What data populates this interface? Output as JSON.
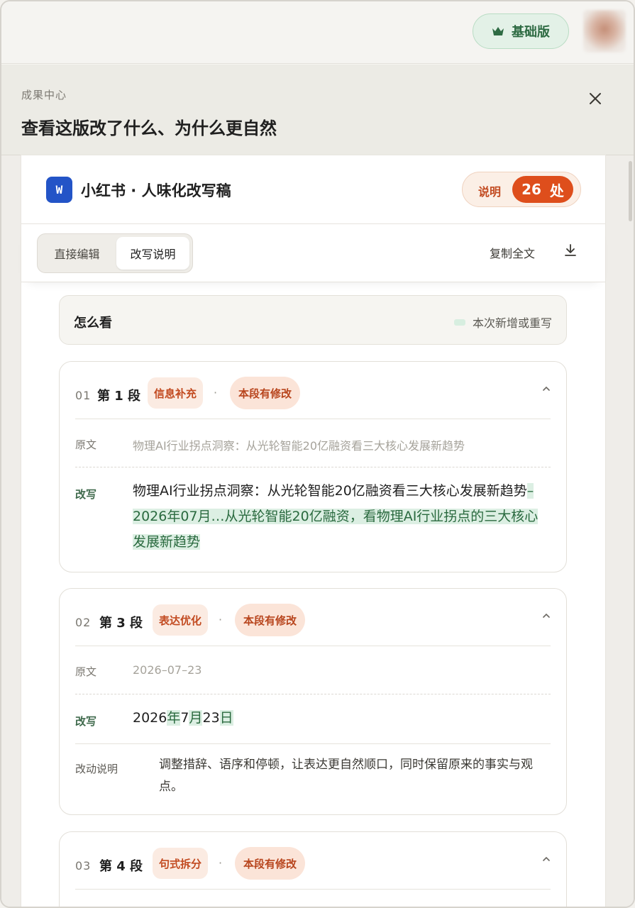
{
  "header": {
    "plan_label": "基础版",
    "plan_icon": "crown-icon"
  },
  "drawer": {
    "kicker": "成果中心",
    "title": "查看这版改了什么、为什么更自然"
  },
  "document": {
    "icon_letter": "W",
    "title": "小红书 · 人味化改写稿",
    "notes_label": "说明",
    "notes_count": "26",
    "notes_unit": "处"
  },
  "toolbar": {
    "tabs": [
      {
        "label": "直接编辑",
        "active": false
      },
      {
        "label": "改写说明",
        "active": true
      }
    ],
    "copy_all": "复制全文"
  },
  "howto": {
    "title": "怎么看",
    "legend": "本次新增或重写",
    "legend_color": "#d7eee0"
  },
  "cards": [
    {
      "num": "01",
      "segment": "第 1 段",
      "type": "信息补充",
      "sep": "·",
      "status": "本段有修改",
      "orig_label": "原文",
      "orig": "物理AI行业拐点洞察：从光轮智能20亿融资看三大核心发展新趋势",
      "rw_label": "改写",
      "rw_plain": "物理AI行业拐点洞察：从光轮智能20亿融资看三大核心发展新趋势",
      "rw_added": "–2026年07月…从光轮智能20亿融资，看物理AI行业拐点的三大核心发展新趋势"
    },
    {
      "num": "02",
      "segment": "第 3 段",
      "type": "表达优化",
      "sep": "·",
      "status": "本段有修改",
      "orig_label": "原文",
      "orig": "2026–07–23",
      "rw_label": "改写",
      "rw_parts": [
        "2026",
        "年",
        "7",
        "月",
        "23",
        "日"
      ],
      "note_label": "改动说明",
      "note": "调整措辞、语序和停顿，让表达更自然顺口，同时保留原来的事实与观点。"
    },
    {
      "num": "03",
      "segment": "第 4 段",
      "type": "句式拆分",
      "sep": "·",
      "status": "本段有修改"
    }
  ],
  "colors": {
    "accent_orange": "#de4e1c",
    "accent_green": "#2e6b43",
    "highlight_green": "#dcefe3",
    "doc_blue": "#2354c7"
  }
}
